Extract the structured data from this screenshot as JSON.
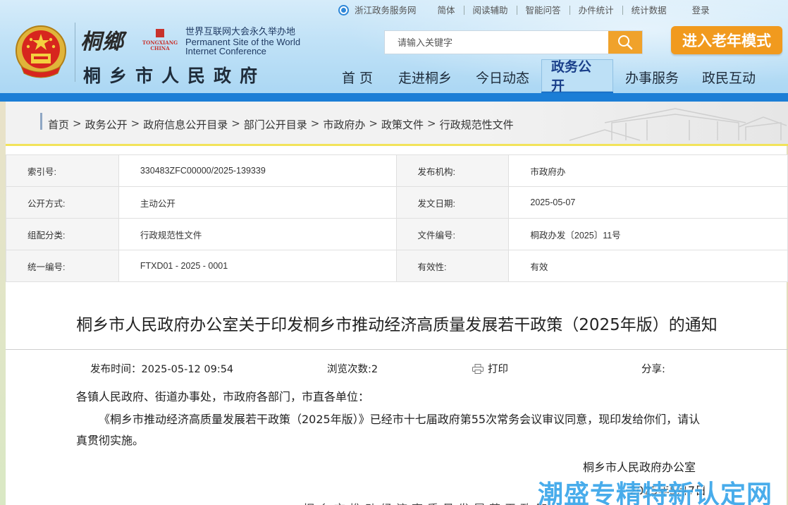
{
  "header": {
    "topbar": {
      "portal": "浙江政务服务网",
      "links": [
        "简体",
        "阅读辅助",
        "智能问答",
        "办件统计",
        "统计数据"
      ],
      "login": "登录"
    },
    "logo_calligraphy": "桐鄉",
    "logo_pinyin_1": "TONGXIANG",
    "logo_pinyin_2": "CHINA",
    "wic_cn": "世界互联网大会永久举办地",
    "wic_en_1": "Permanent Site of the World",
    "wic_en_2": "Internet Conference",
    "site_title": "桐乡市人民政府",
    "search_placeholder": "请输入关键字",
    "elder_mode": "进入老年模式",
    "nav": [
      "首 页",
      "走进桐乡",
      "今日动态",
      "政务公开",
      "办事服务",
      "政民互动"
    ],
    "nav_active_index": 3,
    "accent_color": "#1b7ed6",
    "orange_color": "#f19a1e"
  },
  "breadcrumb": [
    "首页",
    "政务公开",
    "政府信息公开目录",
    "部门公开目录",
    "市政府办",
    "政策文件",
    "行政规范性文件"
  ],
  "meta": {
    "rows": [
      {
        "k1": "索引号:",
        "v1": "330483ZFC00000/2025-139339",
        "k2": "发布机构:",
        "v2": "市政府办"
      },
      {
        "k1": "公开方式:",
        "v1": "主动公开",
        "k2": "发文日期:",
        "v2": "2025-05-07"
      },
      {
        "k1": "组配分类:",
        "v1": "行政规范性文件",
        "k2": "文件编号:",
        "v2": "桐政办发〔2025〕11号"
      },
      {
        "k1": "统一编号:",
        "v1": "FTXD01 - 2025 - 0001",
        "k2": "有效性:",
        "v2": "有效"
      }
    ]
  },
  "article": {
    "title": "桐乡市人民政府办公室关于印发桐乡市推动经济高质量发展若干政策（2025年版）的通知",
    "publish_time": "发布时间：2025-05-12  09:54",
    "views": "浏览次数:2",
    "print": "打印",
    "share": "分享:",
    "salutation": "各镇人民政府、街道办事处，市政府各部门，市直各单位：",
    "paragraph": "《桐乡市推动经济高质量发展若干政策（2025年版）》已经市十七届政府第55次常务会议审议同意，现印发给你们，请认真贯彻实施。",
    "signer": "桐乡市人民政府办公室",
    "date": "2025年5月7日",
    "partial_line": "桐乡市推动经济高质量发展若干政策"
  },
  "watermark": "潮盛专精特新认定网"
}
